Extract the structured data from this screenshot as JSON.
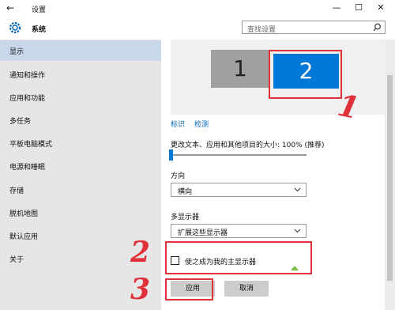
{
  "window": {
    "title": "设置",
    "back_glyph": "←",
    "minimize_glyph": "—",
    "maximize_glyph": "☐",
    "close_glyph": "✕"
  },
  "header": {
    "section_title": "系统",
    "search_placeholder": "查找设置"
  },
  "sidebar": {
    "items": [
      {
        "label": "显示",
        "active": true
      },
      {
        "label": "通知和操作"
      },
      {
        "label": "应用和功能"
      },
      {
        "label": "多任务"
      },
      {
        "label": "平板电脑模式"
      },
      {
        "label": "电源和睡眠"
      },
      {
        "label": "存储"
      },
      {
        "label": "脱机地图"
      },
      {
        "label": "默认应用"
      },
      {
        "label": "关于"
      }
    ]
  },
  "main": {
    "monitors": [
      {
        "label": "1"
      },
      {
        "label": "2",
        "selected": true
      }
    ],
    "identify_link": "标识",
    "detect_link": "检测",
    "scale_label": "更改文本、应用和其他项目的大小: 100% (推荐)",
    "scale_value_percent": 100,
    "orientation_label": "方向",
    "orientation_value": "横向",
    "multi_display_label": "多显示器",
    "multi_display_value": "扩展这些显示器",
    "main_display_checkbox": "使之成为我的主显示器",
    "main_display_checked": false,
    "apply_button": "应用",
    "cancel_button": "取消"
  },
  "annotations": {
    "step1": "1",
    "step2": "2",
    "step3": "3"
  },
  "colors": {
    "accent": "#0078d7",
    "annotation_red": "#e0303a",
    "sidebar_bg": "#e6e6e6",
    "active_bg": "#c8d8ea"
  }
}
